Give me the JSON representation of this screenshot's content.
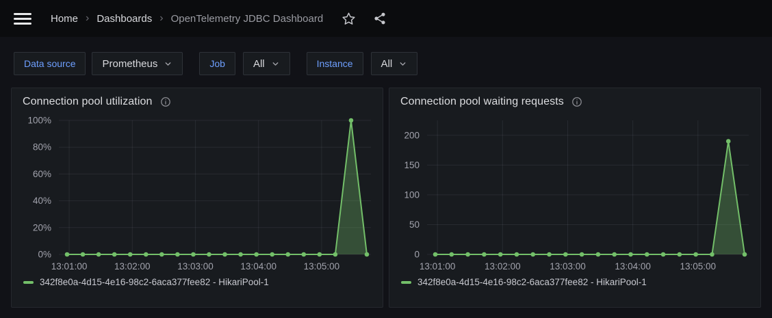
{
  "colors": {
    "accent_blue": "#6e9fff",
    "series_green": "#73bf69",
    "navbar_bg": "#0b0c0e",
    "page_bg": "#111217",
    "panel_bg": "#181b1f"
  },
  "navbar": {
    "breadcrumbs": {
      "0": {
        "label": "Home"
      },
      "1": {
        "label": "Dashboards"
      },
      "2": {
        "label": "OpenTelemetry JDBC Dashboard"
      }
    },
    "separator": "›",
    "icons": {
      "menu": "hamburger-menu",
      "star": "star-outline",
      "share": "share-alt"
    }
  },
  "filters": {
    "datasource": {
      "label": "Data source",
      "value": "Prometheus"
    },
    "job": {
      "label": "Job",
      "value": "All"
    },
    "instance": {
      "label": "Instance",
      "value": "All"
    }
  },
  "chart_data": [
    {
      "type": "line",
      "title": "Connection pool utilization",
      "legend_position": "bottom",
      "grid": true,
      "ylim": [
        0,
        100
      ],
      "y_ticks": [
        0,
        20,
        40,
        60,
        80,
        100
      ],
      "y_unit": "%",
      "y_axis_width": 54,
      "x_ticks": [
        "13:01:00",
        "13:02:00",
        "13:03:00",
        "13:04:00",
        "13:05:00"
      ],
      "series": [
        {
          "name": "342f8e0a-4d15-4e16-98c2-6aca377fee82 - HikariPool-1",
          "color": "#73bf69",
          "fill_opacity": 0.32,
          "points": [
            [
              "13:00:58",
              0
            ],
            [
              "13:01:13",
              0
            ],
            [
              "13:01:28",
              0
            ],
            [
              "13:01:43",
              0
            ],
            [
              "13:01:58",
              0
            ],
            [
              "13:02:13",
              0
            ],
            [
              "13:02:28",
              0
            ],
            [
              "13:02:43",
              0
            ],
            [
              "13:02:58",
              0
            ],
            [
              "13:03:13",
              0
            ],
            [
              "13:03:28",
              0
            ],
            [
              "13:03:43",
              0
            ],
            [
              "13:03:58",
              0
            ],
            [
              "13:04:13",
              0
            ],
            [
              "13:04:28",
              0
            ],
            [
              "13:04:43",
              0
            ],
            [
              "13:04:58",
              0
            ],
            [
              "13:05:13",
              0
            ],
            [
              "13:05:28",
              100
            ],
            [
              "13:05:43",
              0
            ]
          ]
        }
      ]
    },
    {
      "type": "line",
      "title": "Connection pool waiting requests",
      "legend_position": "bottom",
      "grid": true,
      "ylim": [
        0,
        225
      ],
      "y_ticks": [
        0,
        50,
        100,
        150,
        200
      ],
      "y_unit": "",
      "y_axis_width": 40,
      "x_ticks": [
        "13:01:00",
        "13:02:00",
        "13:03:00",
        "13:04:00",
        "13:05:00"
      ],
      "series": [
        {
          "name": "342f8e0a-4d15-4e16-98c2-6aca377fee82 - HikariPool-1",
          "color": "#73bf69",
          "fill_opacity": 0.32,
          "points": [
            [
              "13:00:58",
              0
            ],
            [
              "13:01:13",
              0
            ],
            [
              "13:01:28",
              0
            ],
            [
              "13:01:43",
              0
            ],
            [
              "13:01:58",
              0
            ],
            [
              "13:02:13",
              0
            ],
            [
              "13:02:28",
              0
            ],
            [
              "13:02:43",
              0
            ],
            [
              "13:02:58",
              0
            ],
            [
              "13:03:13",
              0
            ],
            [
              "13:03:28",
              0
            ],
            [
              "13:03:43",
              0
            ],
            [
              "13:03:58",
              0
            ],
            [
              "13:04:13",
              0
            ],
            [
              "13:04:28",
              0
            ],
            [
              "13:04:43",
              0
            ],
            [
              "13:04:58",
              0
            ],
            [
              "13:05:13",
              0
            ],
            [
              "13:05:28",
              190
            ],
            [
              "13:05:43",
              0
            ]
          ]
        }
      ]
    }
  ]
}
